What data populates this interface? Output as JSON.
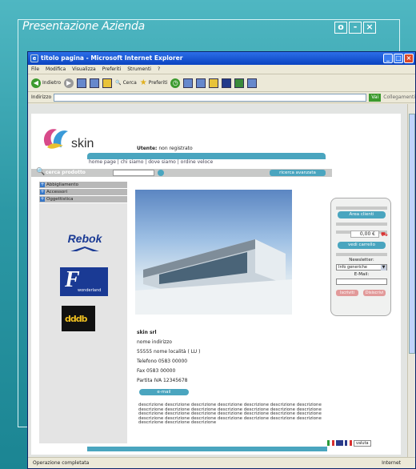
{
  "frame": {
    "title": "Presentazione Azienda"
  },
  "browser": {
    "window_title": "titolo pagina - Microsoft Internet Explorer",
    "menu": [
      "File",
      "Modifica",
      "Visualizza",
      "Preferiti",
      "Strumenti",
      "?"
    ],
    "toolbar": {
      "back": "Indietro",
      "search": "Cerca",
      "favorites": "Preferiti"
    },
    "address_label": "Indirizzo",
    "go_label": "Vai",
    "links_label": "Collegamenti",
    "status_text": "Operazione completata",
    "zone_text": "Internet"
  },
  "site": {
    "logo_text": "skin",
    "user_label": "Utente:",
    "user_value": "non registrato",
    "nav": "home page | chi siamo | dove siamo | ordine veloce",
    "search_label": "cerca prodotto",
    "advanced_search": "ricerca avanzata",
    "categories": [
      "Abbigliamento",
      "Accessori",
      "Oggettistica"
    ],
    "brands": {
      "rebok": "Rebok",
      "f_letter": "F",
      "f_sub": "wonderland",
      "dd": "dddb"
    },
    "company": {
      "name": "skin srl",
      "address": "nome indirizzo",
      "city": "55555 nome località ( LU )",
      "phone": "Telefono 0583 00000",
      "fax": "Fax 0583 00000",
      "vat": "Partita IVA 12345678"
    },
    "email_button": "e-mail",
    "description": "descrizione descrizione descrizione descrizione descrizione descrizione descrizione descrizione descrizione descrizione descrizione descrizione descrizione descrizione descrizione descrizione descrizione descrizione descrizione descrizione descrizione descrizione descrizione descrizione descrizione descrizione descrizione descrizione descrizione descrizione descrizione",
    "valuta": "valuta",
    "right_panel": {
      "area_clienti": "Area clienti",
      "price": "0,00 €",
      "vedi_carrello": "vedi carrello",
      "newsletter": "Newsletter:",
      "newsletter_option": "Info generiche",
      "email_label": "E-Mail:",
      "subscribe": "Iscriviti",
      "unsubscribe": "Disiscrivi"
    }
  },
  "colors": {
    "background": "#2f9aa6",
    "site_accent": "#4aa5bf",
    "ie_titlebar": "#0a43c0"
  }
}
